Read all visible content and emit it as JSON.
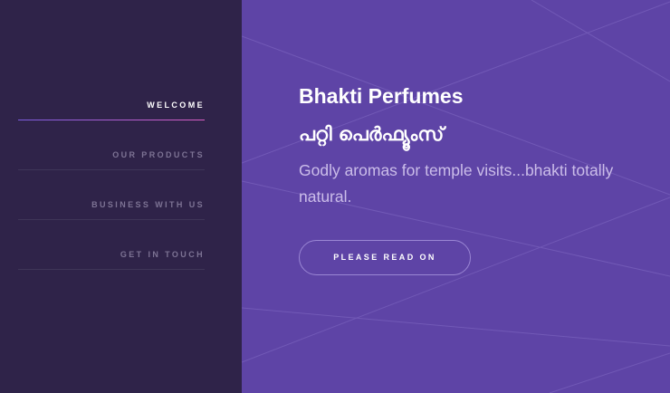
{
  "nav": {
    "items": [
      {
        "label": "WELCOME",
        "active": true
      },
      {
        "label": "OUR PRODUCTS",
        "active": false
      },
      {
        "label": "BUSINESS WITH US",
        "active": false
      },
      {
        "label": "GET IN TOUCH",
        "active": false
      }
    ]
  },
  "hero": {
    "title": "Bhakti Perfumes",
    "subtitle": "പറ്റി പെർഫ്യൂംസ്",
    "description": "Godly aromas for temple visits...bhakti totally natural.",
    "cta_label": "PLEASE READ ON"
  },
  "colors": {
    "sidebar_bg": "#2f2349",
    "main_bg": "#5e44a6",
    "accent_gradient_start": "#7c5de0",
    "accent_gradient_end": "#d95fc4"
  }
}
